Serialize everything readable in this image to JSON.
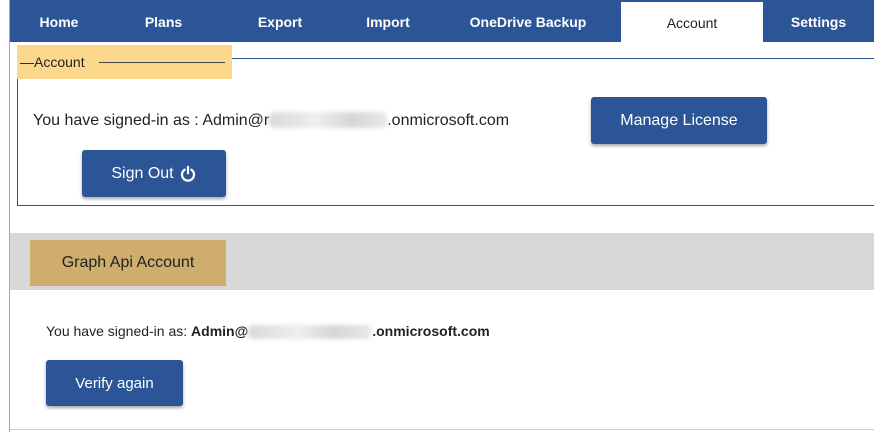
{
  "tabs": [
    {
      "label": "Home"
    },
    {
      "label": "Plans"
    },
    {
      "label": "Export"
    },
    {
      "label": "Import"
    },
    {
      "label": "OneDrive Backup"
    },
    {
      "label": "Account",
      "active": true
    },
    {
      "label": "Settings"
    }
  ],
  "account": {
    "legend": "Account",
    "signin_prefix": "You have signed-in as : Admin@",
    "signin_partial_char": "r",
    "signin_suffix": ".onmicrosoft.com",
    "manage_license_label": "Manage License",
    "sign_out_label": "Sign Out"
  },
  "graph": {
    "header": "Graph Api Account",
    "signin_prefix": "You have signed-in as: ",
    "signin_user": "Admin@",
    "signin_suffix": ".onmicrosoft.com",
    "verify_label": "Verify again"
  },
  "colors": {
    "primary": "#2b5597",
    "legend_bg": "#fbd88c",
    "graph_label_bg": "#cfae6d",
    "graph_header_bg": "#d8d8d8"
  },
  "icons": {
    "sign_out": "power-icon"
  }
}
